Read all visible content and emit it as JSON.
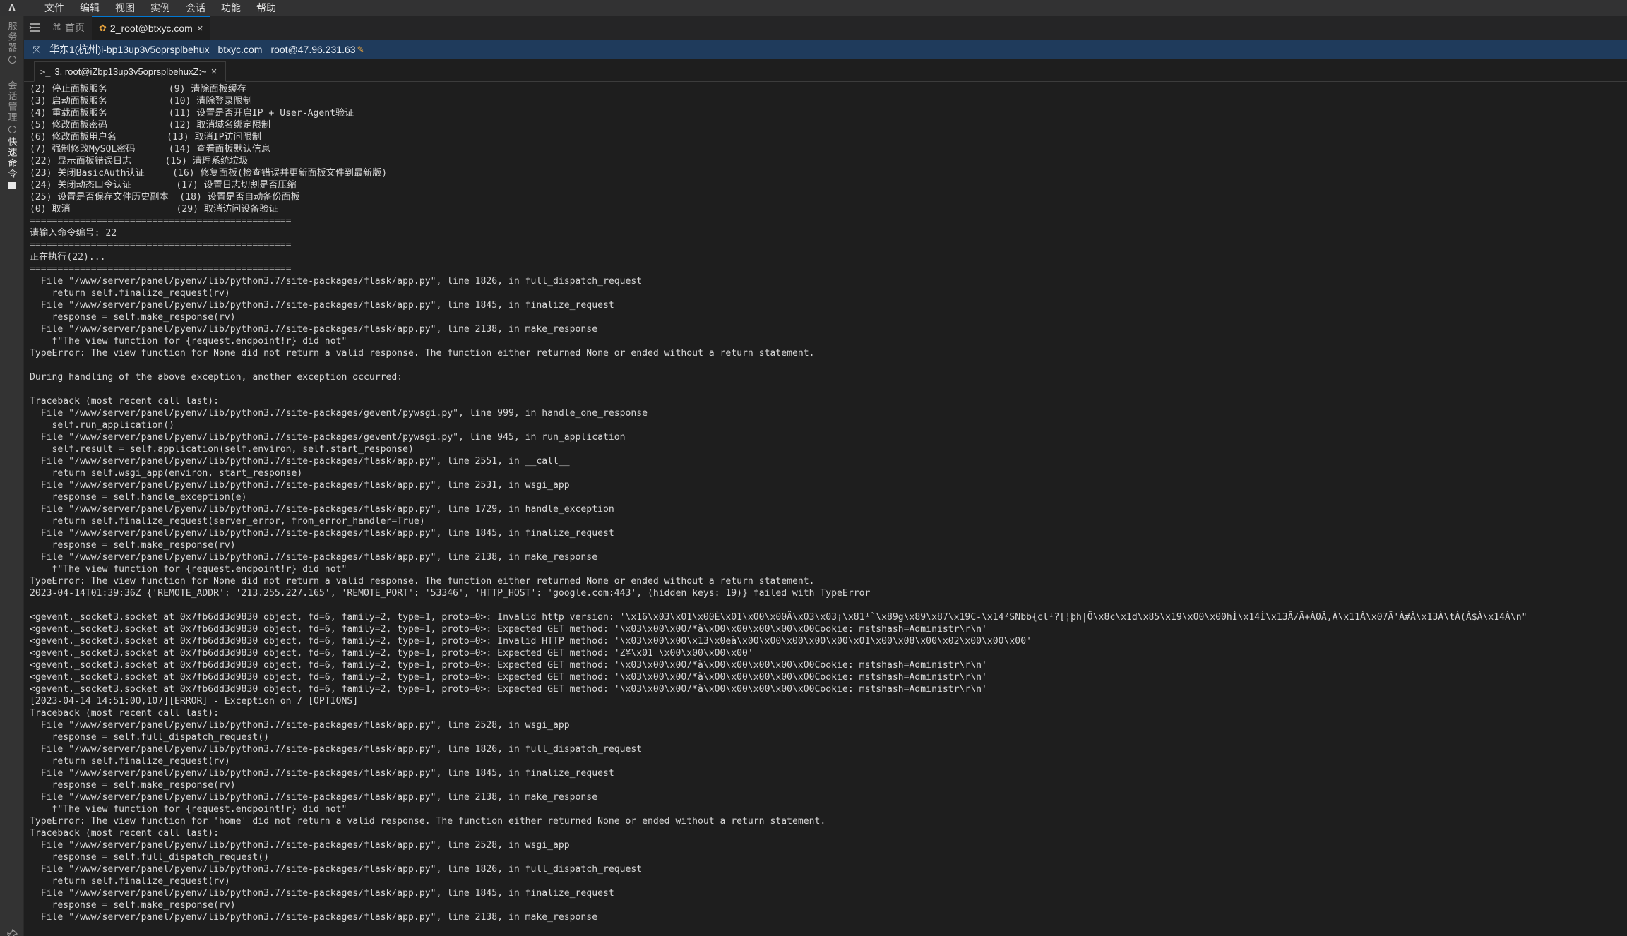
{
  "menubar": {
    "logo": "Λ",
    "items": [
      "文件",
      "编辑",
      "视图",
      "实例",
      "会话",
      "功能",
      "帮助"
    ]
  },
  "sidebar": {
    "tabs": [
      "服务器",
      "会话管理",
      "快速命令"
    ]
  },
  "tabs": [
    {
      "label": "首页",
      "icon": "home-icon",
      "active": false
    },
    {
      "label": "2_root@btxyc.com",
      "icon": "server-icon",
      "active": true,
      "close": "×"
    }
  ],
  "infobar": {
    "region": "华东1(杭州)i-bp13up3v5oprsplbehux",
    "host": "btxyc.com",
    "user": "root@47.96.231.63"
  },
  "terminal_tab": {
    "prompt": ">_",
    "label": "3. root@iZbp13up3v5oprsplbehuxZ:~",
    "close": "×"
  },
  "terminal": {
    "lines": [
      "(2) 停止面板服务           (9) 清除面板缓存",
      "(3) 启动面板服务           (10) 清除登录限制",
      "(4) 重载面板服务           (11) 设置是否开启IP + User-Agent验证",
      "(5) 修改面板密码           (12) 取消域名绑定限制",
      "(6) 修改面板用户名         (13) 取消IP访问限制",
      "(7) 强制修改MySQL密码      (14) 查看面板默认信息",
      "(22) 显示面板错误日志      (15) 清理系统垃圾",
      "(23) 关闭BasicAuth认证     (16) 修复面板(检查错误并更新面板文件到最新版)",
      "(24) 关闭动态口令认证        (17) 设置日志切割是否压缩",
      "(25) 设置是否保存文件历史副本  (18) 设置是否自动备份面板",
      "(0) 取消                   (29) 取消访问设备验证",
      "===============================================",
      "请输入命令编号: 22",
      "===============================================",
      "正在执行(22)...",
      "===============================================",
      "  File \"/www/server/panel/pyenv/lib/python3.7/site-packages/flask/app.py\", line 1826, in full_dispatch_request",
      "    return self.finalize_request(rv)",
      "  File \"/www/server/panel/pyenv/lib/python3.7/site-packages/flask/app.py\", line 1845, in finalize_request",
      "    response = self.make_response(rv)",
      "  File \"/www/server/panel/pyenv/lib/python3.7/site-packages/flask/app.py\", line 2138, in make_response",
      "    f\"The view function for {request.endpoint!r} did not\"",
      "TypeError: The view function for None did not return a valid response. The function either returned None or ended without a return statement.",
      "",
      "During handling of the above exception, another exception occurred:",
      "",
      "Traceback (most recent call last):",
      "  File \"/www/server/panel/pyenv/lib/python3.7/site-packages/gevent/pywsgi.py\", line 999, in handle_one_response",
      "    self.run_application()",
      "  File \"/www/server/panel/pyenv/lib/python3.7/site-packages/gevent/pywsgi.py\", line 945, in run_application",
      "    self.result = self.application(self.environ, self.start_response)",
      "  File \"/www/server/panel/pyenv/lib/python3.7/site-packages/flask/app.py\", line 2551, in __call__",
      "    return self.wsgi_app(environ, start_response)",
      "  File \"/www/server/panel/pyenv/lib/python3.7/site-packages/flask/app.py\", line 2531, in wsgi_app",
      "    response = self.handle_exception(e)",
      "  File \"/www/server/panel/pyenv/lib/python3.7/site-packages/flask/app.py\", line 1729, in handle_exception",
      "    return self.finalize_request(server_error, from_error_handler=True)",
      "  File \"/www/server/panel/pyenv/lib/python3.7/site-packages/flask/app.py\", line 1845, in finalize_request",
      "    response = self.make_response(rv)",
      "  File \"/www/server/panel/pyenv/lib/python3.7/site-packages/flask/app.py\", line 2138, in make_response",
      "    f\"The view function for {request.endpoint!r} did not\"",
      "TypeError: The view function for None did not return a valid response. The function either returned None or ended without a return statement.",
      "2023-04-14T01:39:36Z {'REMOTE_ADDR': '213.255.227.165', 'REMOTE_PORT': '53346', 'HTTP_HOST': 'google.com:443', (hidden keys: 19)} failed with TypeError",
      "",
      "<gevent._socket3.socket at 0x7fb6dd3d9830 object, fd=6, family=2, type=1, proto=0>: Invalid http version: '\\x16\\x03\\x01\\x00È\\x01\\x00\\x00Ä\\x03\\x03¡\\x81¹`\\x89g\\x89\\x87\\x19C-\\x14²SNbb{cl¹?[¦þh|Ö\\x8c\\x1d\\x85\\x19\\x00\\x00hÌ\\x14Ì\\x13Ã/Ã+À0Ã,À\\x11À\\x07Ã'À#À\\x13À\\tÀ(À$À\\x14À\\n\"",
      "<gevent._socket3.socket at 0x7fb6dd3d9830 object, fd=6, family=2, type=1, proto=0>: Expected GET method: '\\x03\\x00\\x00/*à\\x00\\x00\\x00\\x00\\x00Cookie: mstshash=Administr\\r\\n'",
      "<gevent._socket3.socket at 0x7fb6dd3d9830 object, fd=6, family=2, type=1, proto=0>: Invalid HTTP method: '\\x03\\x00\\x00\\x13\\x0eà\\x00\\x00\\x00\\x00\\x00\\x01\\x00\\x08\\x00\\x02\\x00\\x00\\x00'",
      "<gevent._socket3.socket at 0x7fb6dd3d9830 object, fd=6, family=2, type=1, proto=0>: Expected GET method: 'Z¥\\x01 \\x00\\x00\\x00\\x00'",
      "<gevent._socket3.socket at 0x7fb6dd3d9830 object, fd=6, family=2, type=1, proto=0>: Expected GET method: '\\x03\\x00\\x00/*à\\x00\\x00\\x00\\x00\\x00Cookie: mstshash=Administr\\r\\n'",
      "<gevent._socket3.socket at 0x7fb6dd3d9830 object, fd=6, family=2, type=1, proto=0>: Expected GET method: '\\x03\\x00\\x00/*à\\x00\\x00\\x00\\x00\\x00Cookie: mstshash=Administr\\r\\n'",
      "<gevent._socket3.socket at 0x7fb6dd3d9830 object, fd=6, family=2, type=1, proto=0>: Expected GET method: '\\x03\\x00\\x00/*à\\x00\\x00\\x00\\x00\\x00Cookie: mstshash=Administr\\r\\n'",
      "[2023-04-14 14:51:00,107][ERROR] - Exception on / [OPTIONS]",
      "Traceback (most recent call last):",
      "  File \"/www/server/panel/pyenv/lib/python3.7/site-packages/flask/app.py\", line 2528, in wsgi_app",
      "    response = self.full_dispatch_request()",
      "  File \"/www/server/panel/pyenv/lib/python3.7/site-packages/flask/app.py\", line 1826, in full_dispatch_request",
      "    return self.finalize_request(rv)",
      "  File \"/www/server/panel/pyenv/lib/python3.7/site-packages/flask/app.py\", line 1845, in finalize_request",
      "    response = self.make_response(rv)",
      "  File \"/www/server/panel/pyenv/lib/python3.7/site-packages/flask/app.py\", line 2138, in make_response",
      "    f\"The view function for {request.endpoint!r} did not\"",
      "TypeError: The view function for 'home' did not return a valid response. The function either returned None or ended without a return statement.",
      "Traceback (most recent call last):",
      "  File \"/www/server/panel/pyenv/lib/python3.7/site-packages/flask/app.py\", line 2528, in wsgi_app",
      "    response = self.full_dispatch_request()",
      "  File \"/www/server/panel/pyenv/lib/python3.7/site-packages/flask/app.py\", line 1826, in full_dispatch_request",
      "    return self.finalize_request(rv)",
      "  File \"/www/server/panel/pyenv/lib/python3.7/site-packages/flask/app.py\", line 1845, in finalize_request",
      "    response = self.make_response(rv)",
      "  File \"/www/server/panel/pyenv/lib/python3.7/site-packages/flask/app.py\", line 2138, in make_response"
    ]
  },
  "colors": {
    "infobar_bg": "#1f3b5c",
    "active_tab_accent": "#0078d4",
    "terminal_bg": "#1e1e1e",
    "terminal_fg": "#d7d7d7"
  }
}
